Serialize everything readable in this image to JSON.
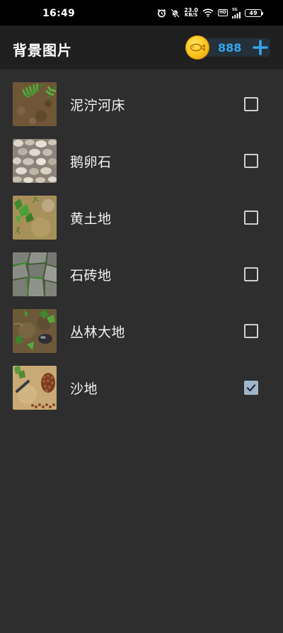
{
  "status_bar": {
    "time": "16:49",
    "net_speed_value": "23.0",
    "net_speed_unit": "KB/S",
    "hd_label": "HD",
    "signal_label": "5G",
    "battery": "49",
    "icons": [
      "alarm-icon",
      "mute-icon",
      "wifi-icon",
      "signal-icon",
      "battery-icon"
    ]
  },
  "header": {
    "title": "背景图片",
    "coins": "888",
    "add_icon": "plus-icon",
    "coin_icon": "fish-coin-icon"
  },
  "backgrounds": [
    {
      "label": "泥泞河床",
      "checked": false,
      "thumb": "muddy-riverbed"
    },
    {
      "label": "鹅卵石",
      "checked": false,
      "thumb": "pebbles"
    },
    {
      "label": "黄土地",
      "checked": false,
      "thumb": "yellow-earth"
    },
    {
      "label": "石砖地",
      "checked": false,
      "thumb": "stone-brick"
    },
    {
      "label": "丛林大地",
      "checked": false,
      "thumb": "jungle-ground"
    },
    {
      "label": "沙地",
      "checked": true,
      "thumb": "sand"
    }
  ],
  "colors": {
    "background": "#2e2e2e",
    "app_bar": "#1f1f1f",
    "accent_blue": "#35a5ea",
    "checked": "#9fb6c9",
    "coin_gold": "#f9c21b"
  }
}
